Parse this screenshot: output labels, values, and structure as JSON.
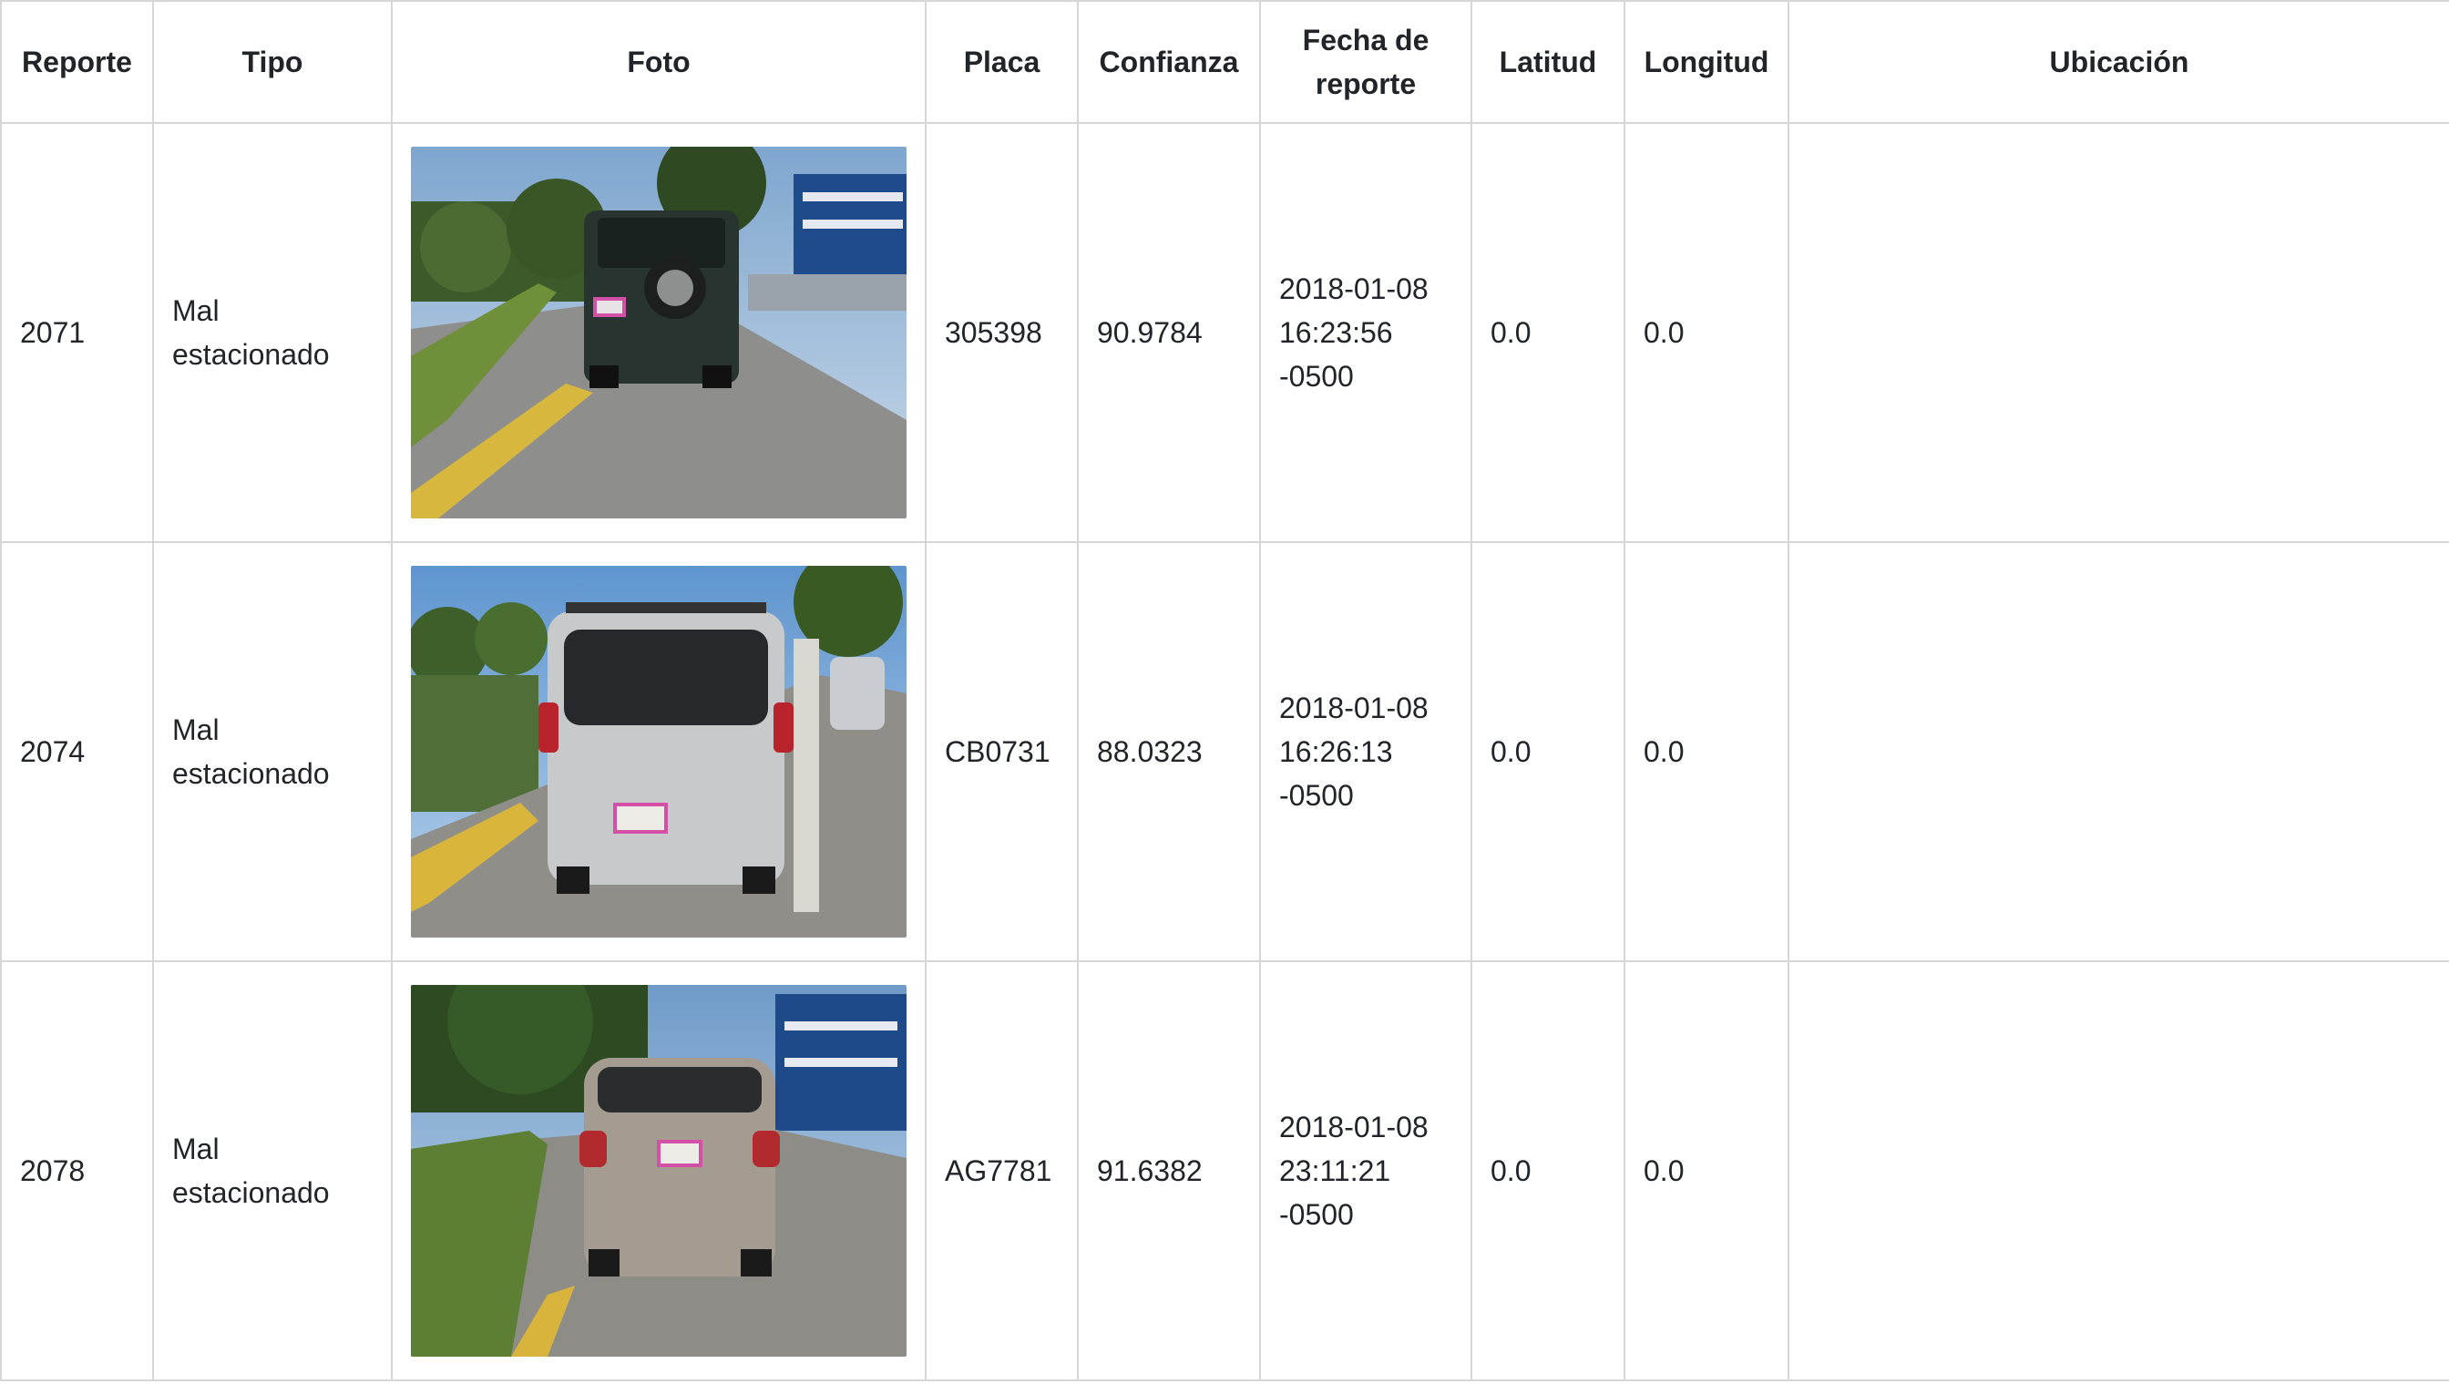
{
  "table": {
    "headers": {
      "reporte": "Reporte",
      "tipo": "Tipo",
      "foto": "Foto",
      "placa": "Placa",
      "confianza": "Confianza",
      "fecha": "Fecha de\nreporte",
      "latitud": "Latitud",
      "longitud": "Longitud",
      "ubicacion": "Ubicación"
    },
    "rows": [
      {
        "reporte": "2071",
        "tipo": "Mal\nestacionado",
        "photo_icon": "suv-photo",
        "placa": "305398",
        "confianza": "90.9784",
        "fecha": "2018-01-08\n16:23:56\n-0500",
        "latitud": "0.0",
        "longitud": "0.0",
        "ubicacion": ""
      },
      {
        "reporte": "2074",
        "tipo": "Mal\nestacionado",
        "photo_icon": "hatchback-photo",
        "placa": "CB0731",
        "confianza": "88.0323",
        "fecha": "2018-01-08\n16:26:13\n-0500",
        "latitud": "0.0",
        "longitud": "0.0",
        "ubicacion": ""
      },
      {
        "reporte": "2078",
        "tipo": "Mal\nestacionado",
        "photo_icon": "sedan-photo",
        "placa": "AG7781",
        "confianza": "91.6382",
        "fecha": "2018-01-08\n23:11:21\n-0500",
        "latitud": "0.0",
        "longitud": "0.0",
        "ubicacion": ""
      }
    ]
  },
  "colors": {
    "border": "#d6d6d6",
    "text": "#212529",
    "background": "#ffffff"
  }
}
